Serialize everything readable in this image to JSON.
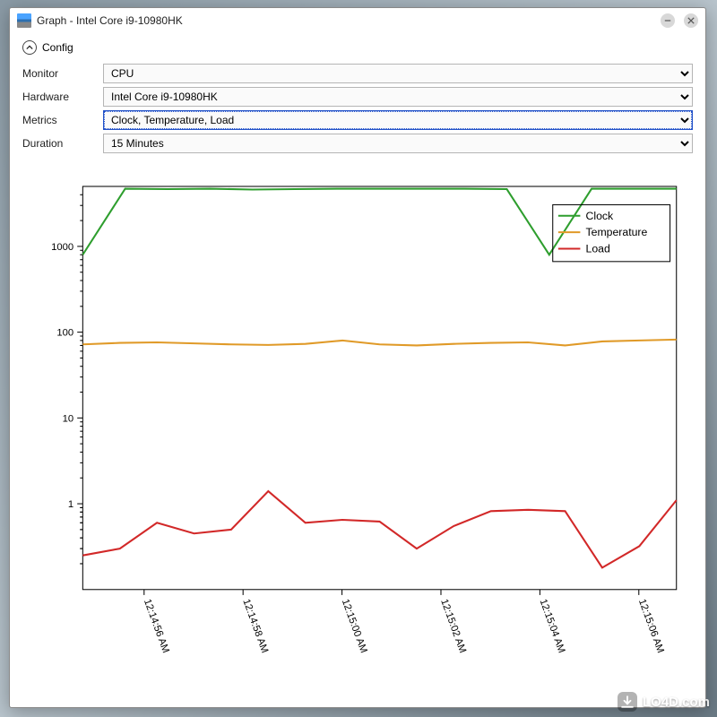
{
  "window": {
    "title": "Graph - Intel Core i9-10980HK"
  },
  "config": {
    "toggle_label": "Config",
    "fields": {
      "monitor": {
        "label": "Monitor",
        "value": "CPU"
      },
      "hardware": {
        "label": "Hardware",
        "value": "Intel Core i9-10980HK"
      },
      "metrics": {
        "label": "Metrics",
        "value": "Clock, Temperature, Load"
      },
      "duration": {
        "label": "Duration",
        "value": "15 Minutes"
      }
    }
  },
  "chart_data": {
    "type": "line",
    "yscale": "log",
    "ylim": [
      0.1,
      5000
    ],
    "yticks": [
      1,
      10,
      100,
      1000
    ],
    "x_labels": [
      "12:14:56 AM",
      "12:14:58 AM",
      "12:15:00 AM",
      "12:15:02 AM",
      "12:15:04 AM",
      "12:15:06 AM"
    ],
    "series": [
      {
        "name": "Clock",
        "color": "#2e9e2e",
        "values": [
          800,
          4700,
          4650,
          4700,
          4600,
          4650,
          4700,
          4700,
          4700,
          4700,
          4650,
          800,
          4700,
          4700,
          4700
        ]
      },
      {
        "name": "Temperature",
        "color": "#e09a28",
        "values": [
          72,
          75,
          76,
          74,
          72,
          71,
          73,
          80,
          72,
          70,
          73,
          75,
          76,
          70,
          78,
          80,
          82
        ]
      },
      {
        "name": "Load",
        "color": "#d22828",
        "values": [
          0.25,
          0.3,
          0.6,
          0.45,
          0.5,
          1.4,
          0.6,
          0.65,
          0.62,
          0.3,
          0.55,
          0.82,
          0.85,
          0.82,
          0.18,
          0.32,
          1.1
        ]
      }
    ],
    "legend": [
      "Clock",
      "Temperature",
      "Load"
    ]
  },
  "watermark": {
    "text": "LO4D.com"
  }
}
